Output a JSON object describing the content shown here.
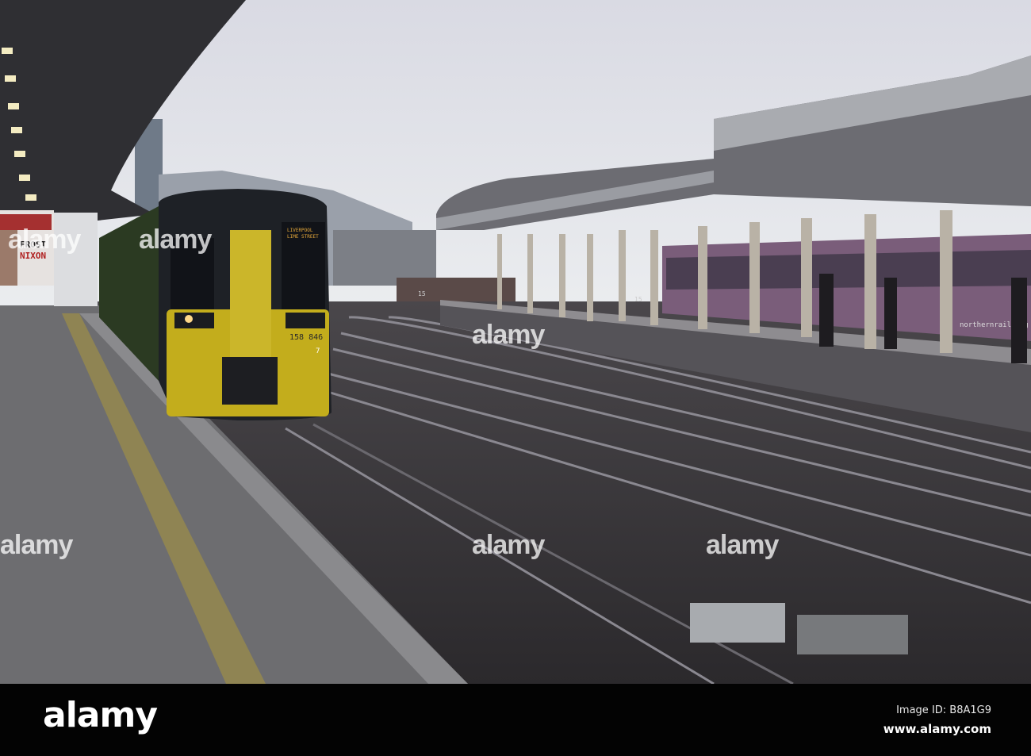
{
  "scene": {
    "train_destination_line1": "LIVERPOOL",
    "train_destination_line2": "LIME STREET",
    "train_number": "158 846",
    "train_car_number": "7",
    "poster_title_1": "FROST",
    "poster_title_2": "NIXON",
    "platform_marker_1": "15",
    "platform_marker_2": "15",
    "far_train_livery_text": "northernrail.org"
  },
  "watermarks": [
    "alamy",
    "alamy",
    "alamy",
    "alamy",
    "alamy",
    "alamy"
  ],
  "footer": {
    "logo": "alamy",
    "image_id": "Image ID: B8A1G9",
    "url": "www.alamy.com"
  },
  "colors": {
    "sky": "#e4e6ec",
    "train_yellow": "#c9b21a",
    "platform": "#6d6d70",
    "ballast": "#3f3d40"
  }
}
